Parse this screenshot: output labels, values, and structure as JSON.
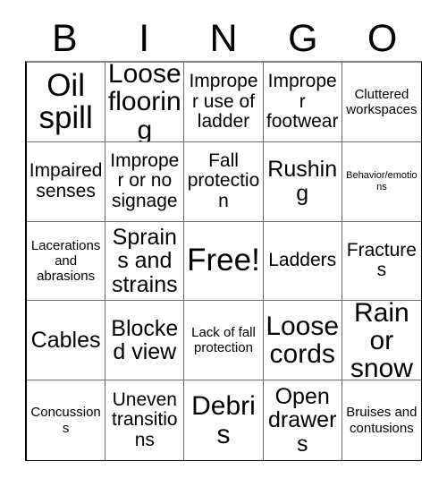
{
  "card": {
    "title": "BINGO",
    "headers": [
      "B",
      "I",
      "N",
      "G",
      "O"
    ],
    "free_space_label": "Free!",
    "rows": [
      [
        {
          "text": "Oil spill",
          "size": "fs-xxl"
        },
        {
          "text": "Loose flooring",
          "size": "fs-xl"
        },
        {
          "text": "Improper use of ladder",
          "size": "fs-m"
        },
        {
          "text": "Improper footwear",
          "size": "fs-m"
        },
        {
          "text": "Cluttered workspaces",
          "size": "fs-s"
        }
      ],
      [
        {
          "text": "Impaired senses",
          "size": "fs-m"
        },
        {
          "text": "Improper or no signage",
          "size": "fs-m"
        },
        {
          "text": "Fall protection",
          "size": "fs-m"
        },
        {
          "text": "Rushing",
          "size": "fs-l"
        },
        {
          "text": "Behavior/emotions",
          "size": "fs-xs"
        }
      ],
      [
        {
          "text": "Lacerations and abrasions",
          "size": "fs-s"
        },
        {
          "text": "Sprains and strains",
          "size": "fs-l"
        },
        {
          "text": "Free!",
          "size": "fs-xxl"
        },
        {
          "text": "Ladders",
          "size": "fs-m"
        },
        {
          "text": "Fractures",
          "size": "fs-m"
        }
      ],
      [
        {
          "text": "Cables",
          "size": "fs-l"
        },
        {
          "text": "Blocked view",
          "size": "fs-l"
        },
        {
          "text": "Lack of fall protection",
          "size": "fs-s"
        },
        {
          "text": "Loose cords",
          "size": "fs-xl"
        },
        {
          "text": "Rain or snow",
          "size": "fs-xl"
        }
      ],
      [
        {
          "text": "Concussions",
          "size": "fs-s"
        },
        {
          "text": "Uneven transitions",
          "size": "fs-m"
        },
        {
          "text": "Debris",
          "size": "fs-xl"
        },
        {
          "text": "Open drawers",
          "size": "fs-l"
        },
        {
          "text": "Bruises and contusions",
          "size": "fs-s"
        }
      ]
    ],
    "colors": {
      "background": "#ffffff",
      "text": "#000000",
      "grid_line": "#6e6e6e",
      "border_top": "#808080",
      "border_outer": "#000000"
    }
  }
}
